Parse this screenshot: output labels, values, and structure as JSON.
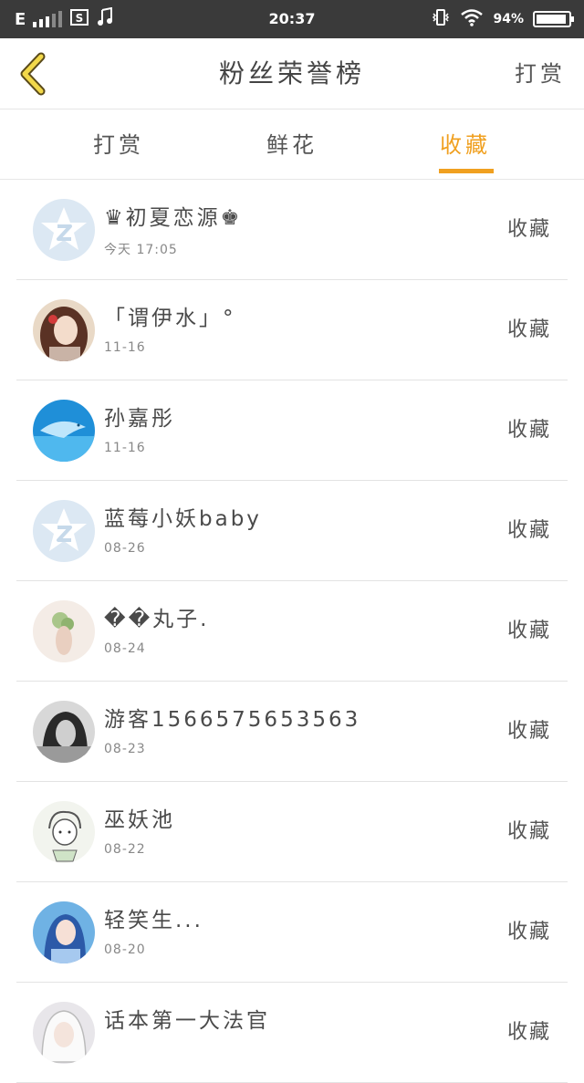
{
  "status_bar": {
    "network": "E",
    "time": "20:37",
    "battery_text": "94%",
    "battery_level": 0.94
  },
  "header": {
    "title": "粉丝荣誉榜",
    "action_label": "打赏"
  },
  "tabs": [
    {
      "label": "打赏",
      "active": false
    },
    {
      "label": "鲜花",
      "active": false
    },
    {
      "label": "收藏",
      "active": true
    }
  ],
  "colors": {
    "accent": "#f0a020",
    "status_bar_bg": "#3a3a3a",
    "text": "#4a4a4a",
    "divider": "#e3e3e3"
  },
  "fans": [
    {
      "name": "♛初夏恋源♚",
      "date": "今天 17:05",
      "action": "收藏",
      "avatar": "default-avatar-icon"
    },
    {
      "name": "「谓伊水」°",
      "date": "11-16",
      "action": "收藏",
      "avatar": "girl-avatar"
    },
    {
      "name": "孙嘉彤",
      "date": "11-16",
      "action": "收藏",
      "avatar": "dolphin-avatar"
    },
    {
      "name": "蓝莓小妖baby",
      "date": "08-26",
      "action": "收藏",
      "avatar": "default-avatar-icon"
    },
    {
      "name": "��丸子.",
      "date": "08-24",
      "action": "收藏",
      "avatar": "flower-avatar"
    },
    {
      "name": "游客1566575653563",
      "date": "08-23",
      "action": "收藏",
      "avatar": "bw-portrait-avatar"
    },
    {
      "name": "巫妖池",
      "date": "08-22",
      "action": "收藏",
      "avatar": "sketch-boy-avatar"
    },
    {
      "name": "轻笑生...",
      "date": "08-20",
      "action": "收藏",
      "avatar": "anime-blue-avatar"
    },
    {
      "name": "话本第一大法官",
      "date": "",
      "action": "收藏",
      "avatar": "white-hair-avatar"
    }
  ]
}
